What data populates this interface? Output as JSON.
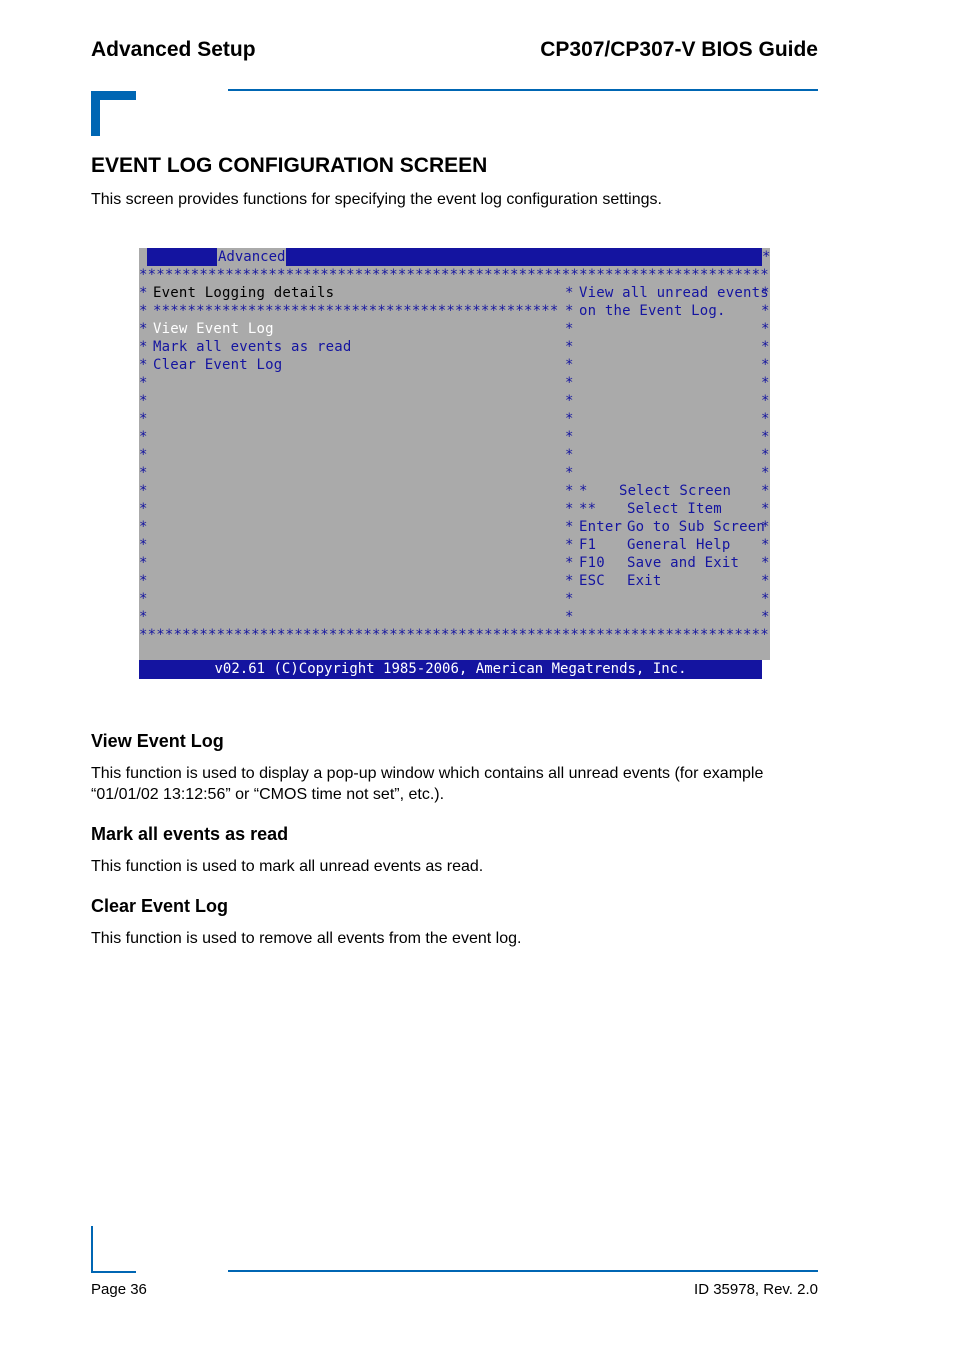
{
  "header": {
    "section": "Advanced Setup",
    "guide_title": "CP307/CP307-V BIOS Guide"
  },
  "page_title": "EVENT LOG CONFIGURATION SCREEN",
  "intro": "This screen provides functions for specifying the event log configuration settings.",
  "bios": {
    "active_tab": "Advanced",
    "topbar_star": "*",
    "left_panel": {
      "heading": "Event Logging details",
      "items": [
        {
          "label": "View Event Log",
          "selected": true
        },
        {
          "label": "Mark all events as read",
          "selected": false
        },
        {
          "label": "Clear Event Log",
          "selected": false
        }
      ]
    },
    "help_panel": {
      "lines": [
        "View all unread events",
        "on the Event Log."
      ]
    },
    "keys": [
      {
        "key": "*",
        "action": "Select Screen"
      },
      {
        "key": "**",
        "action": "Select Item"
      },
      {
        "key": "Enter",
        "action": "Go to Sub Screen"
      },
      {
        "key": "F1",
        "action": "General Help"
      },
      {
        "key": "F10",
        "action": "Save and Exit"
      },
      {
        "key": "ESC",
        "action": "Exit"
      }
    ],
    "copyright": "v02.61 (C)Copyright 1985-2006, American Megatrends, Inc."
  },
  "functions": [
    {
      "title": "View Event Log",
      "description": "This function is used to display a pop-up window which contains all unread events (for example “01/01/02 13:12:56” or “CMOS time not set”, etc.)."
    },
    {
      "title": "Mark all events as read",
      "description": "This function is used to mark all unread events as read."
    },
    {
      "title": "Clear Event Log",
      "description": "This function is used to remove all events from the event log."
    }
  ],
  "footer": {
    "page": "Page 36",
    "doc_id": "ID 35978, Rev. 2.0"
  }
}
